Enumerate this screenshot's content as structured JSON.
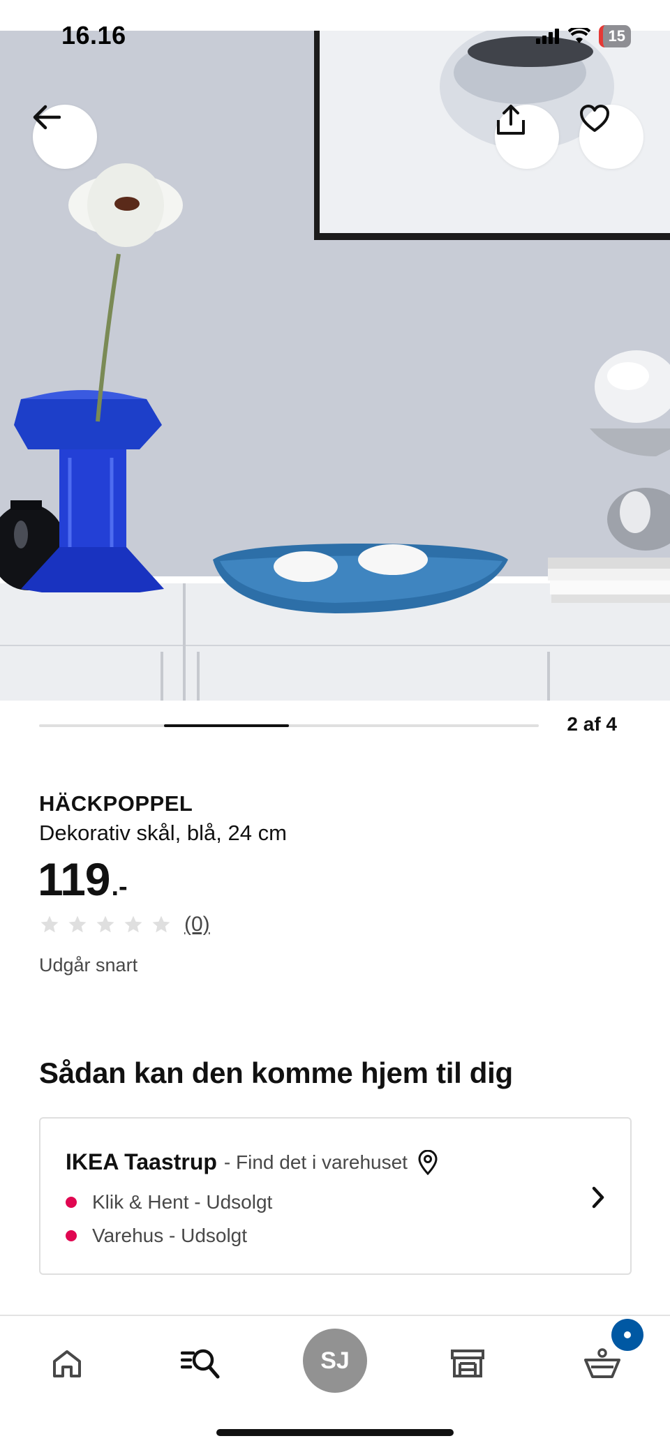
{
  "status_bar": {
    "time": "16.16",
    "battery": "15"
  },
  "hero": {
    "nav": {
      "back_icon": "arrow-left-icon",
      "share_icon": "share-icon",
      "favorite_icon": "heart-icon"
    }
  },
  "carousel": {
    "counter": "2 af 4",
    "current": 2,
    "total": 4
  },
  "product": {
    "name": "HÄCKPOPPEL",
    "description": "Dekorativ skål, blå, 24 cm",
    "price_integer": "119",
    "price_suffix": ".-",
    "rating_value": 0,
    "rating_max": 5,
    "rating_count": "(0)",
    "availability_note": "Udgår snart"
  },
  "delivery": {
    "title": "Sådan kan den komme hjem til dig",
    "store": {
      "name": "IKEA Taastrup",
      "subtitle": "- Find det i varehuset",
      "stock": [
        {
          "label": "Klik & Hent - Udsolgt",
          "status_color": "#e00751"
        },
        {
          "label": "Varehus - Udsolgt",
          "status_color": "#e00751"
        }
      ]
    }
  },
  "bottom_nav": {
    "items": [
      "home-icon",
      "search-icon",
      "profile-avatar",
      "store-icon",
      "basket-icon"
    ],
    "profile_initials": "SJ",
    "basket_badge_color": "#0058a3"
  },
  "colors": {
    "accent": "#0058a3",
    "out_of_stock": "#e00751"
  }
}
